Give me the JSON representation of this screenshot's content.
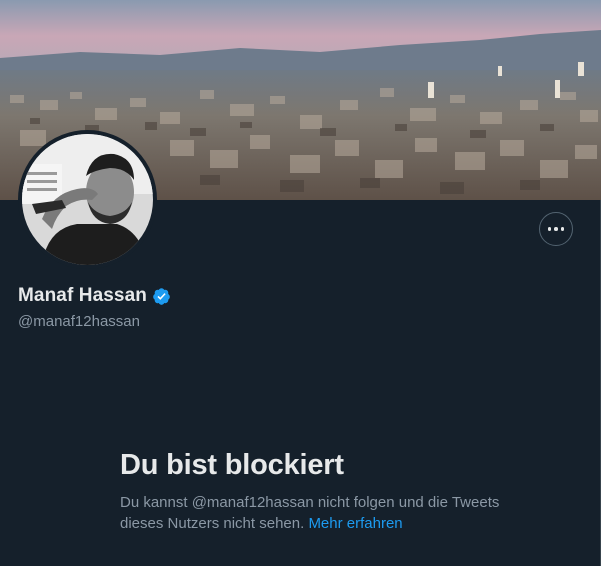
{
  "profile": {
    "display_name": "Manaf Hassan",
    "handle": "@manaf12hassan",
    "verified_icon": "verified-badge-icon",
    "more_icon": "more-options-icon"
  },
  "blocked_notice": {
    "title": "Du bist blockiert",
    "description": "Du kannst @manaf12hassan nicht folgen und die Tweets dieses Nutzers nicht sehen.",
    "link": "Mehr erfahren"
  },
  "colors": {
    "background": "#15202b",
    "text_primary": "#e7e9ea",
    "text_secondary": "#8b98a5",
    "accent": "#1d9bf0"
  }
}
